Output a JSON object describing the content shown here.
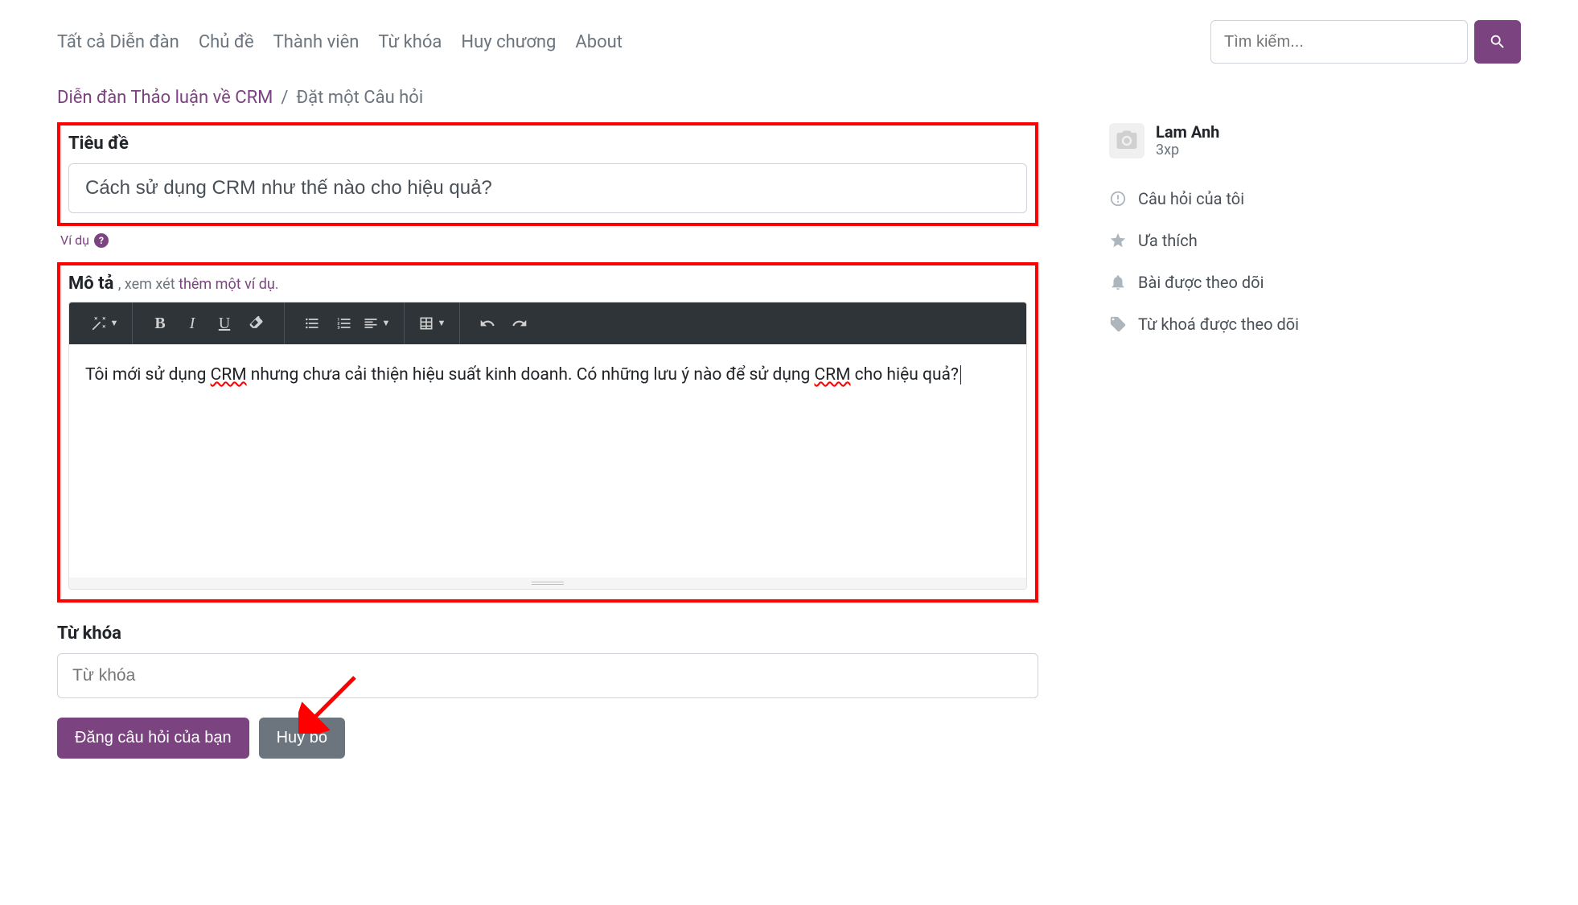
{
  "nav": {
    "items": [
      "Tất cả Diễn đàn",
      "Chủ đề",
      "Thành viên",
      "Từ khóa",
      "Huy chương",
      "About"
    ]
  },
  "search": {
    "placeholder": "Tìm kiếm..."
  },
  "breadcrumb": {
    "parent": "Diễn đàn Thảo luận về CRM",
    "sep": "/",
    "current": "Đặt một Câu hỏi"
  },
  "form": {
    "title_label": "Tiêu đề",
    "title_value": "Cách sử dụng CRM như thế nào cho hiệu quả?",
    "hint_text": "Ví dụ",
    "desc_label": "Mô tả",
    "desc_note_prefix": ", xem xét ",
    "desc_note_link": "thêm một ví dụ",
    "desc_note_suffix": ".",
    "desc_body_parts": {
      "p1": "Tôi mới sử dụng ",
      "u1": "CRM",
      "p2": " nhưng chưa cải thiện hiệu suất kinh doanh. Có những lưu ý nào để sử dụng ",
      "u2": "CRM",
      "p3": " cho hiệu quả?"
    },
    "tags_label": "Từ khóa",
    "tags_placeholder": "Từ khóa",
    "submit": "Đăng câu hỏi của bạn",
    "cancel": "Huỷ bỏ"
  },
  "sidebar": {
    "user": {
      "name": "Lam Anh",
      "xp": "3xp"
    },
    "links": [
      "Câu hỏi của tôi",
      "Ưa thích",
      "Bài được theo dõi",
      "Từ khoá được theo dõi"
    ]
  }
}
